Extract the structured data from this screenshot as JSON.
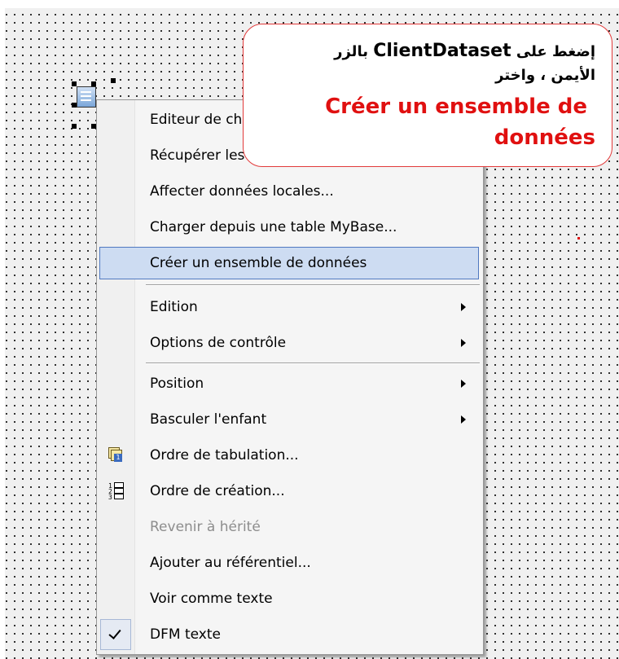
{
  "context_menu": {
    "items": [
      {
        "label": "Editeur de champs..."
      },
      {
        "label": "Récupérer les paramètres"
      },
      {
        "label": "Affecter données locales..."
      },
      {
        "label": "Charger depuis une table MyBase..."
      },
      {
        "label": "Créer un ensemble de données",
        "state": "highlighted"
      },
      {
        "label": "Edition",
        "submenu": true
      },
      {
        "label": "Options de contrôle",
        "submenu": true
      },
      {
        "label": "Position",
        "submenu": true
      },
      {
        "label": "Basculer l'enfant",
        "submenu": true
      },
      {
        "label": "Ordre de tabulation...",
        "icon": "tab-order-icon"
      },
      {
        "label": "Ordre de création...",
        "icon": "creation-order-icon"
      },
      {
        "label": "Revenir à hérité",
        "state": "disabled"
      },
      {
        "label": "Ajouter au référentiel..."
      },
      {
        "label": "Voir comme texte"
      },
      {
        "label": "DFM texte",
        "checked": true
      }
    ]
  },
  "callout": {
    "line1_prefix_ar": "إضغط على",
    "line1_component": "ClientDataset",
    "line1_suffix_ar": "بالزر",
    "line2_ar": "الأيمن ، واختر",
    "line3_fr": "Créer un ensemble de",
    "line4_fr": "données",
    "border_color": "#e23a3a",
    "text_color_fr": "#e01010"
  },
  "colors": {
    "highlight_bg": "#cddcf2",
    "highlight_border": "#4f78c0"
  }
}
